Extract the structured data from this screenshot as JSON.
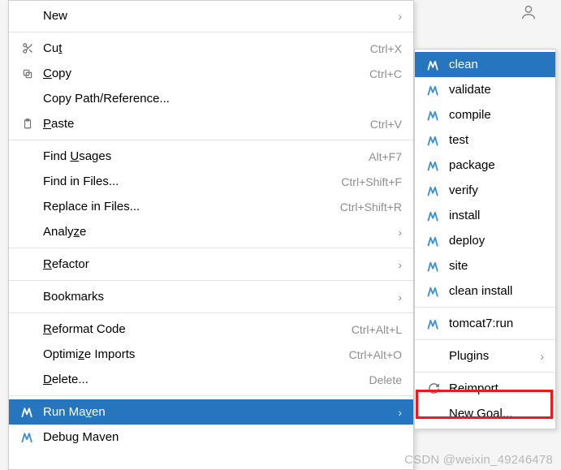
{
  "mainMenu": {
    "new": "New",
    "cut": {
      "pre": "Cu",
      "u": "t",
      "post": ""
    },
    "cut_sc": "Ctrl+X",
    "copy": {
      "pre": "",
      "u": "C",
      "post": "opy"
    },
    "copy_sc": "Ctrl+C",
    "copyPath": "Copy Path/Reference...",
    "paste": {
      "pre": "",
      "u": "P",
      "post": "aste"
    },
    "paste_sc": "Ctrl+V",
    "findUsages": {
      "pre": "Find ",
      "u": "U",
      "post": "sages"
    },
    "findUsages_sc": "Alt+F7",
    "findInFiles": "Find in Files...",
    "findInFiles_sc": "Ctrl+Shift+F",
    "replaceInFiles": "Replace in Files...",
    "replaceInFiles_sc": "Ctrl+Shift+R",
    "analyze": {
      "pre": "Analy",
      "u": "z",
      "post": "e"
    },
    "refactor": {
      "pre": "",
      "u": "R",
      "post": "efactor"
    },
    "bookmarks": "Bookmarks",
    "reformat": {
      "pre": "",
      "u": "R",
      "post": "eformat Code"
    },
    "reformat_sc": "Ctrl+Alt+L",
    "optimize": {
      "pre": "Optimi",
      "u": "z",
      "post": "e Imports"
    },
    "optimize_sc": "Ctrl+Alt+O",
    "delete": {
      "pre": "",
      "u": "D",
      "post": "elete..."
    },
    "delete_sc": "Delete",
    "runMaven": {
      "pre": "Run Ma",
      "u": "v",
      "post": "en"
    },
    "debugMaven": {
      "pre": "Debu",
      "u": "g",
      "post": " Maven"
    }
  },
  "subMenu": {
    "clean": "clean",
    "validate": "validate",
    "compile": "compile",
    "test": "test",
    "package": "package",
    "verify": "verify",
    "install": "install",
    "deploy": "deploy",
    "site": "site",
    "cleanInstall": "clean install",
    "tomcat": "tomcat7:run",
    "plugins": "Plugins",
    "reimport": "Reimport",
    "newGoal": "New Goal..."
  },
  "watermark": "CSDN @weixin_49246478"
}
